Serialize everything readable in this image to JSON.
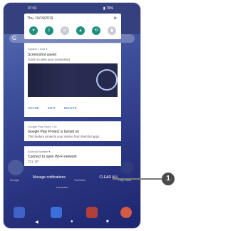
{
  "status_bar": {
    "time": "07:01",
    "battery": "▮ 79%"
  },
  "quick_settings": {
    "date": "Thu, 10/19/2019",
    "settings_icon": "gear-icon",
    "tiles": [
      {
        "icon": "wifi-icon",
        "glyph": "▾",
        "active": true
      },
      {
        "icon": "bluetooth-icon",
        "glyph": "ᛒ",
        "active": true
      },
      {
        "icon": "dnd-icon",
        "glyph": "⊖",
        "active": false
      },
      {
        "icon": "flashlight-icon",
        "glyph": "▲",
        "active": true
      },
      {
        "icon": "rotate-icon",
        "glyph": "⟲",
        "active": true
      },
      {
        "icon": "battery-saver-icon",
        "glyph": "▮",
        "active": false
      }
    ]
  },
  "notifications": [
    {
      "meta": "System • now ▾",
      "title": "Screenshot saved",
      "body": "Touch to view your screenshot",
      "actions": [
        "SHARE",
        "EDIT",
        "DELETE"
      ]
    },
    {
      "meta": "Google Play Store • 2d",
      "title": "Google Play Protect is turned on",
      "body": "This feature protects your device from harmful apps"
    },
    {
      "meta": "Android System ▾",
      "title": "Connect to open Wi-Fi network",
      "body": "TCL VP"
    }
  ],
  "footer": {
    "manage": "Manage notifications",
    "clear_all": "CLEAR ALL"
  },
  "home": {
    "labels": [
      "Google",
      "YouTube",
      "Play Store",
      "Launcher"
    ]
  },
  "callout": {
    "number": "1"
  },
  "colors": {
    "tile_active": "#1f8f80",
    "tile_inactive": "#c9ccd2",
    "accent": "#3c6aa8"
  }
}
